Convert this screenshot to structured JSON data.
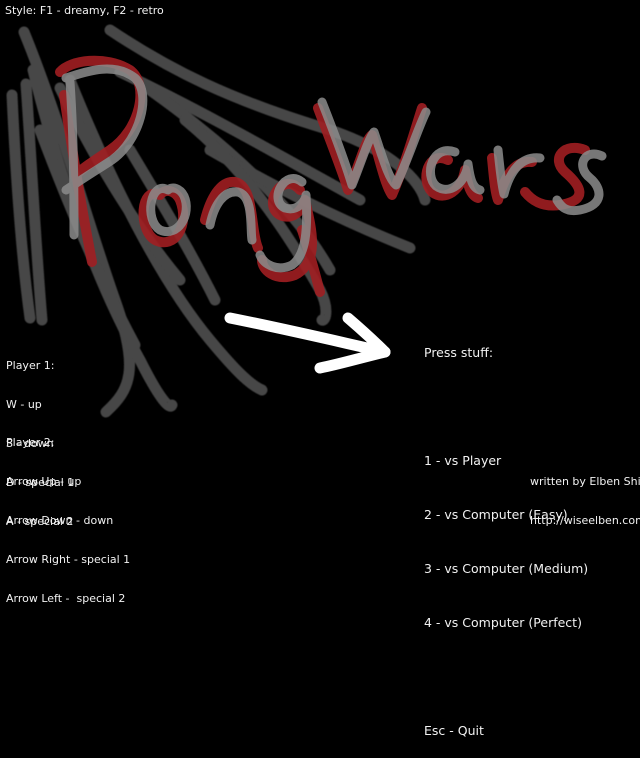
{
  "style_hint": "Style: F1 - dreamy, F2 - retro",
  "title_logo": "PongWars",
  "player1": {
    "heading": "Player 1:",
    "controls": [
      "W - up",
      "S - down",
      "D - special 1",
      "A - special 2"
    ]
  },
  "player2": {
    "heading": "Player 2:",
    "controls": [
      "Arrow Up - up",
      "Arrow Down - down",
      "Arrow Right - special 1",
      "Arrow Left -  special 2"
    ]
  },
  "menu": {
    "prompt": "Press stuff:",
    "options": [
      "1 - vs Player",
      "2 - vs Computer (Easy)",
      "3 - vs Computer (Medium)",
      "4 - vs Computer (Perfect)"
    ],
    "quit": "Esc - Quit"
  },
  "credits": {
    "author": "written by Elben Shira",
    "url": "http://wiseelben.com"
  },
  "colors": {
    "background": "#000000",
    "text": "#f2f2f2",
    "stroke_gray": "#4a4a4a",
    "logo_red": "#a01e22",
    "logo_gray": "#8f8f8f",
    "arrow": "#ffffff"
  }
}
